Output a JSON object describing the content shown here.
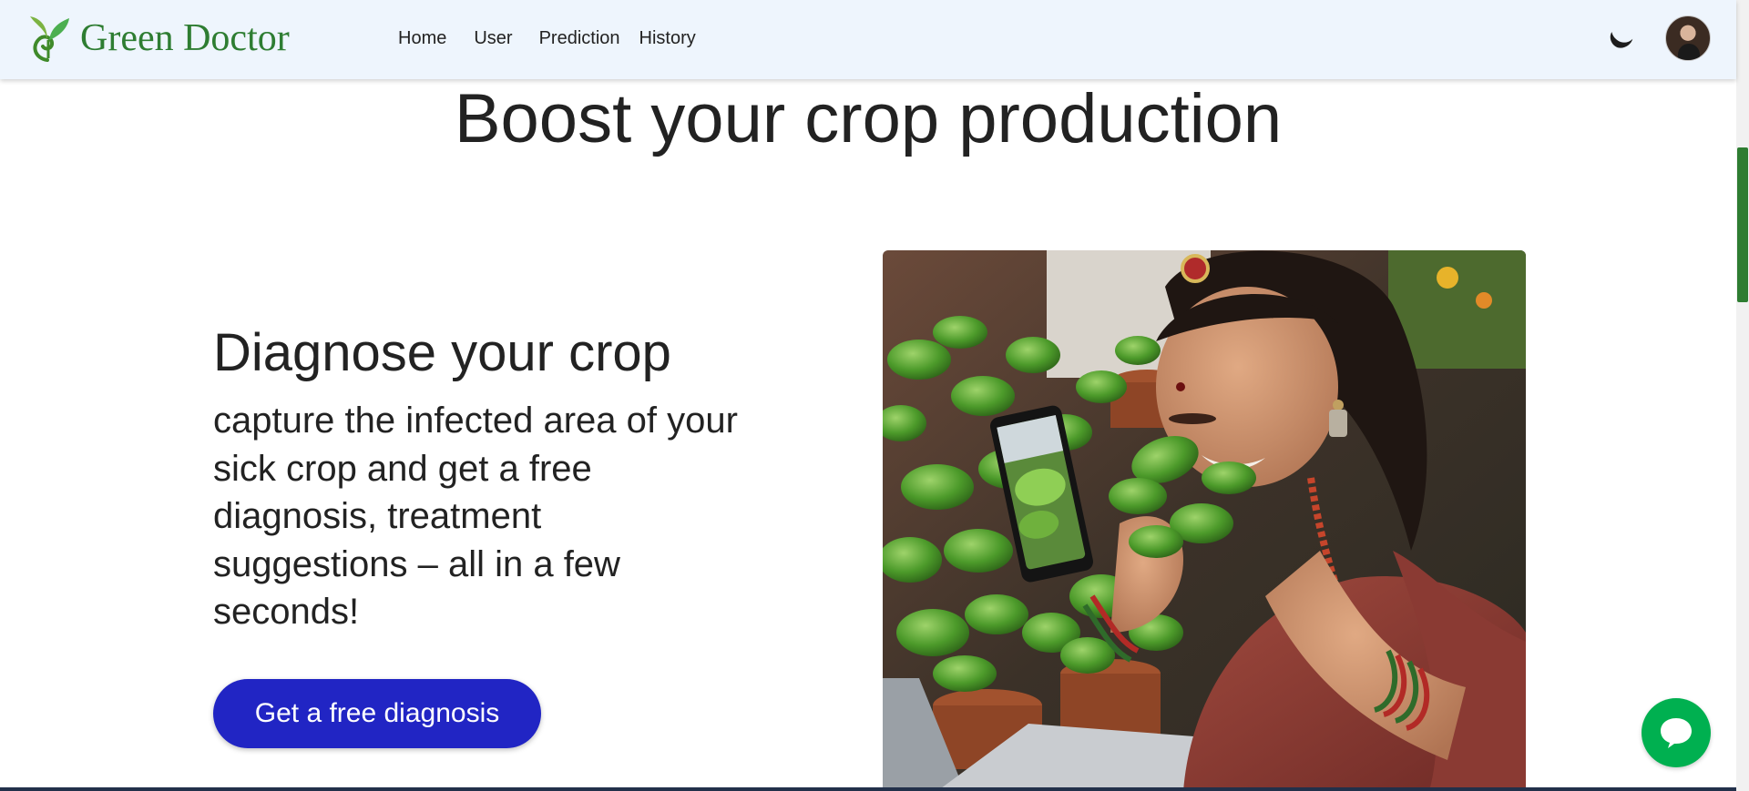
{
  "header": {
    "brand_name": "Green Doctor",
    "nav": [
      "Home",
      "User",
      "Prediction",
      "History"
    ],
    "theme_icon": "moon-icon",
    "avatar_icon": "user-avatar"
  },
  "hero": {
    "title": "Boost your crop production"
  },
  "section": {
    "title": "Diagnose your crop",
    "description": "capture the infected area of your sick crop and get a free diagnosis, treatment suggestions – all in a few seconds!",
    "cta_label": "Get a free diagnosis"
  },
  "chat": {
    "icon": "chat-bubble-icon"
  },
  "colors": {
    "brand_green": "#2e7d32",
    "nav_background": "#eef5fd",
    "cta_blue": "#2125c4",
    "chat_green": "#00b050"
  }
}
